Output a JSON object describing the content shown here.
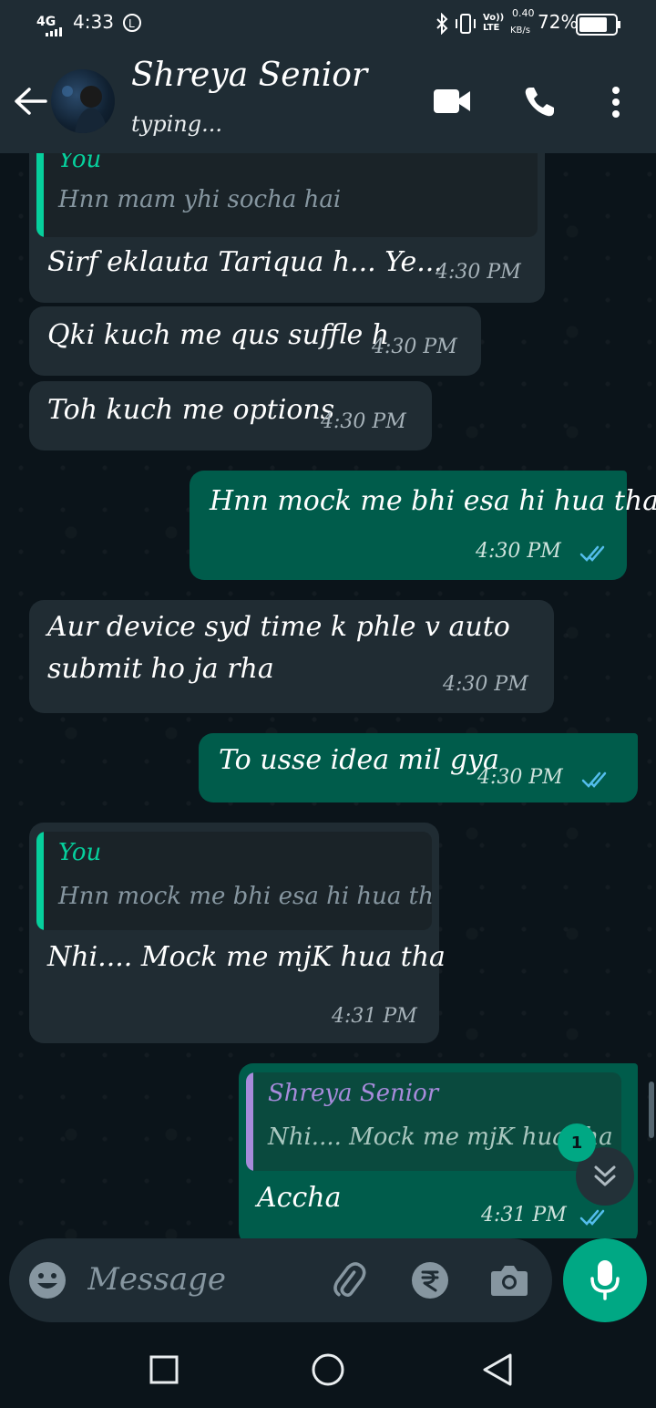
{
  "status_bar": {
    "network": "4G",
    "time": "4:33",
    "data_speed_value": "0.40",
    "data_speed_unit": "KB/s",
    "volte": "Vo)) LTE",
    "battery": "72%"
  },
  "header": {
    "contact_name": "Shreya Senior",
    "status": "typing..."
  },
  "messages": [
    {
      "dir": "in",
      "quote_author": "You",
      "quote_text": "Hnn mam yhi socha hai",
      "text": "Sirf eklauta Tariqua h... Ye...",
      "time": "4:30 PM"
    },
    {
      "dir": "in",
      "text": "Qki kuch me qus suffle h",
      "time": "4:30 PM"
    },
    {
      "dir": "in",
      "text": "Toh kuch me options",
      "time": "4:30 PM"
    },
    {
      "dir": "out",
      "text": "Hnn mock me bhi esa hi hua tha",
      "time": "4:30 PM"
    },
    {
      "dir": "in",
      "text_line1": "Aur device syd time k phle v auto",
      "text_line2": "submit ho ja rha",
      "time": "4:30 PM"
    },
    {
      "dir": "out",
      "text": "To usse idea mil gya",
      "time": "4:30 PM"
    },
    {
      "dir": "in",
      "quote_author": "You",
      "quote_text": "Hnn mock me bhi esa hi hua tha",
      "text": "Nhi.... Mock me mjK hua tha",
      "time": "4:31 PM"
    },
    {
      "dir": "out",
      "quote_author": "Shreya Senior",
      "quote_text": "Nhi.... Mock me mjK hua tha",
      "text": "Accha",
      "time": "4:31 PM"
    }
  ],
  "scroll_fab": {
    "unread_count": "1"
  },
  "input": {
    "placeholder": "Message"
  },
  "colors": {
    "incoming_bubble": "#202c33",
    "outgoing_bubble": "#005c4b",
    "accent": "#00a884",
    "read_tick": "#53bdeb",
    "quote_you": "#06cf9c",
    "quote_contact": "#a78bdb"
  },
  "icons": [
    "back-arrow-icon",
    "video-call-icon",
    "phone-icon",
    "more-options-icon",
    "emoji-icon",
    "attach-icon",
    "rupee-payment-icon",
    "camera-icon",
    "mic-icon",
    "scroll-down-icon",
    "recent-apps-icon",
    "home-icon",
    "back-nav-icon"
  ]
}
